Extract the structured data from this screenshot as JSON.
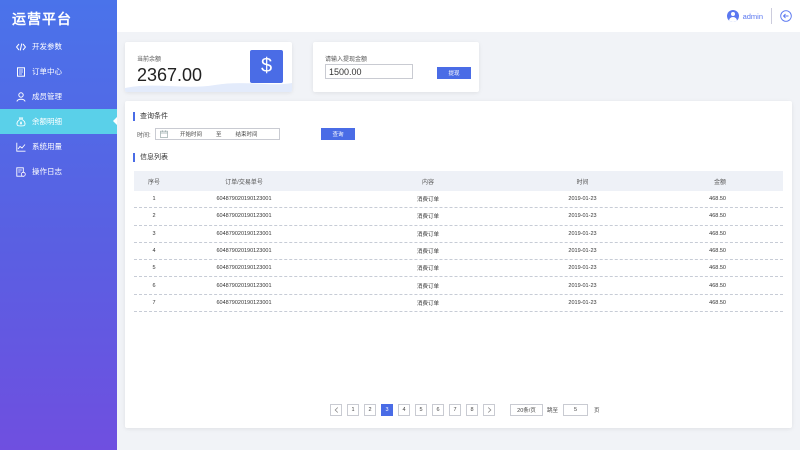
{
  "app": {
    "title": "运营平台"
  },
  "sidebar": {
    "items": [
      {
        "label": "开发参数",
        "icon": "code-icon"
      },
      {
        "label": "订单中心",
        "icon": "document-icon"
      },
      {
        "label": "成员管理",
        "icon": "user-icon"
      },
      {
        "label": "余额明细",
        "icon": "money-bag-icon",
        "active": true
      },
      {
        "label": "系统用量",
        "icon": "line-chart-icon"
      },
      {
        "label": "操作日志",
        "icon": "log-icon"
      }
    ]
  },
  "header": {
    "username": "admin"
  },
  "balance": {
    "label": "当前余额",
    "value": "2367.00"
  },
  "withdraw": {
    "label": "请输入提现金额",
    "amount": "1500.00",
    "button": "提现"
  },
  "query": {
    "title": "查询条件",
    "time_label": "时间:",
    "start_placeholder": "开始时间",
    "to": "至",
    "end_placeholder": "结束时间",
    "button": "查询"
  },
  "list": {
    "title": "信息列表",
    "columns": [
      "序号",
      "订单/交易单号",
      "内容",
      "时间",
      "金额"
    ],
    "rows": [
      [
        "1",
        "604879020190123001",
        "消费订单",
        "2019-01-23",
        "468.50"
      ],
      [
        "2",
        "604879020190123001",
        "消费订单",
        "2019-01-23",
        "468.50"
      ],
      [
        "3",
        "604879020190123001",
        "消费订单",
        "2019-01-23",
        "468.50"
      ],
      [
        "4",
        "604879020190123001",
        "消费订单",
        "2019-01-23",
        "468.50"
      ],
      [
        "5",
        "604879020190123001",
        "消费订单",
        "2019-01-23",
        "468.50"
      ],
      [
        "6",
        "604879020190123001",
        "消费订单",
        "2019-01-23",
        "468.50"
      ],
      [
        "7",
        "604879020190123001",
        "消费订单",
        "2019-01-23",
        "468.50"
      ]
    ]
  },
  "pagination": {
    "pages": [
      "1",
      "2",
      "3",
      "4",
      "5",
      "6",
      "7",
      "8"
    ],
    "current": "3",
    "page_size": "20条/页",
    "jump_label": "跳至",
    "jump_value": "5",
    "page_unit": "页"
  },
  "colors": {
    "accent": "#4a6ce6",
    "active_nav": "#5ad0e9"
  }
}
